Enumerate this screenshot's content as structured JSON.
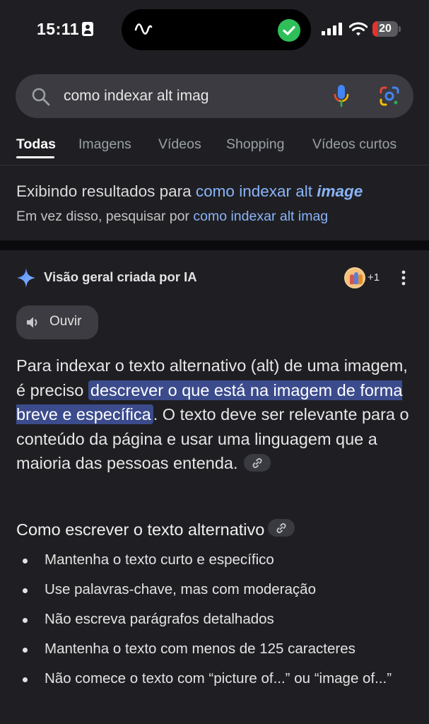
{
  "status_bar": {
    "time": "15:11",
    "battery_level": "20",
    "battery_fraction": 0.2,
    "icons": [
      "contact-card-icon",
      "waveform-icon",
      "check-icon",
      "cellular-signal-icon",
      "wifi-icon",
      "battery-icon"
    ]
  },
  "search": {
    "query": "como indexar alt imag",
    "icons": [
      "search-icon",
      "microphone-icon",
      "google-lens-icon"
    ]
  },
  "tabs": [
    {
      "label": "Todas",
      "active": true
    },
    {
      "label": "Imagens",
      "active": false
    },
    {
      "label": "Vídeos",
      "active": false
    },
    {
      "label": "Shopping",
      "active": false
    },
    {
      "label": "Vídeos curtos",
      "active": false
    }
  ],
  "correction": {
    "showing_prefix": "Exibindo resultados para",
    "corrected_query_normal": "como indexar alt",
    "corrected_query_emphasis": "image",
    "instead_prefix": "Em vez disso, pesquisar por",
    "original_query": "como indexar alt imag"
  },
  "ai_overview": {
    "title": "Visão geral criada por IA",
    "contributors_extra": "+1",
    "listen_label": "Ouvir",
    "answer_part1": "Para indexar o texto alternativo (alt) de uma imagem, é preciso",
    "answer_highlight": "descrever o que está na imagem de forma breve e específica",
    "answer_part2": ". O texto deve ser relevante para o conteúdo da página e usar uma linguagem que a maioria das pessoas entenda.",
    "subheading": "Como escrever o texto alternativo",
    "bullets": [
      "Mantenha o texto curto e específico",
      "Use palavras-chave, mas com moderação",
      "Não escreva parágrafos detalhados",
      "Mantenha o texto com menos de 125 caracteres",
      "Não comece o texto com “picture of...” ou “image of...”"
    ]
  },
  "colors": {
    "background": "#1f1f23",
    "link": "#8ab4f8",
    "highlight": "#3b4b8c",
    "battery_low": "#e0342c",
    "check_green": "#2fbf5a"
  }
}
